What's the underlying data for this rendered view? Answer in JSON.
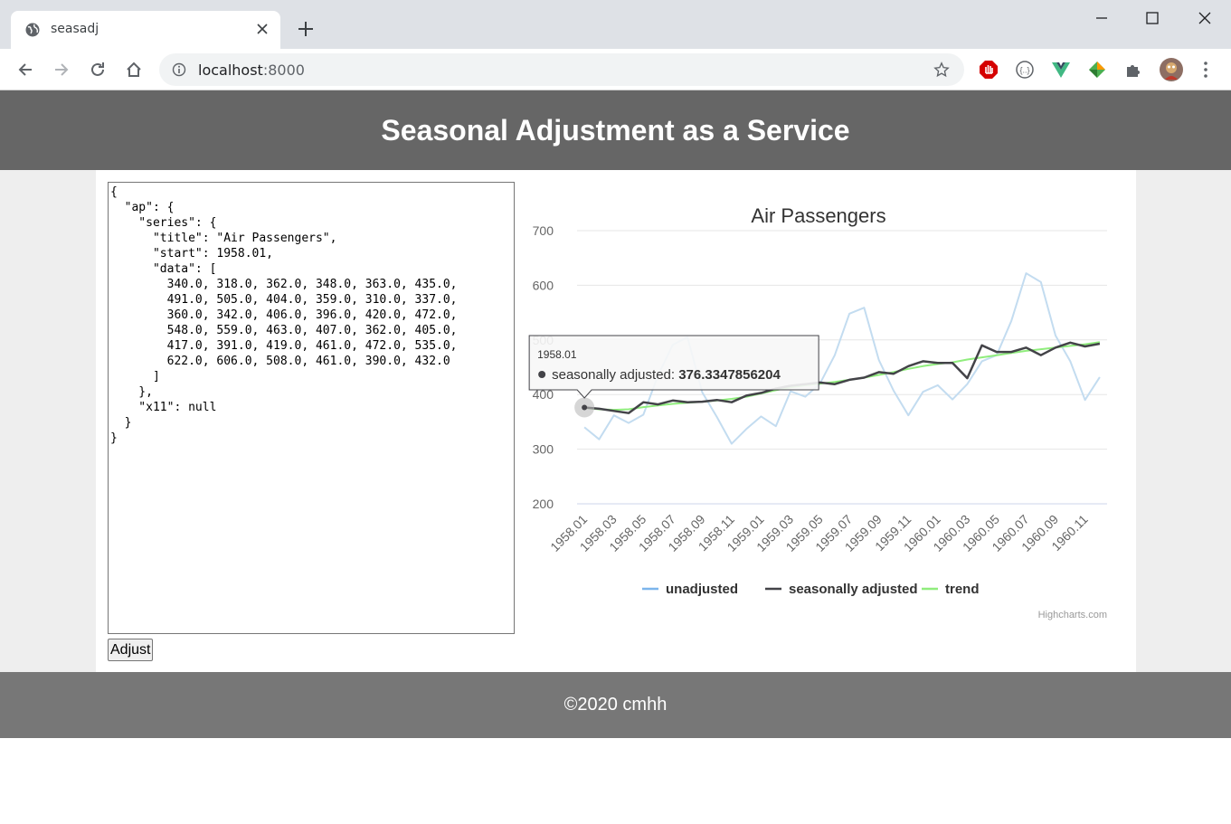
{
  "browser": {
    "tab_title": "seasadj",
    "url_host": "localhost",
    "url_port": ":8000"
  },
  "page": {
    "title": "Seasonal Adjustment as a Service",
    "footer": "©2020 cmhh",
    "adjust_label": "Adjust",
    "editor_text": "{\n  \"ap\": {\n    \"series\": {\n      \"title\": \"Air Passengers\",\n      \"start\": 1958.01,\n      \"data\": [\n        340.0, 318.0, 362.0, 348.0, 363.0, 435.0,\n        491.0, 505.0, 404.0, 359.0, 310.0, 337.0,\n        360.0, 342.0, 406.0, 396.0, 420.0, 472.0,\n        548.0, 559.0, 463.0, 407.0, 362.0, 405.0,\n        417.0, 391.0, 419.0, 461.0, 472.0, 535.0,\n        622.0, 606.0, 508.0, 461.0, 390.0, 432.0\n      ]\n    },\n    \"x11\": null\n  }\n}"
  },
  "chart_data": {
    "type": "line",
    "title": "Air Passengers",
    "credits": "Highcharts.com",
    "ylim": [
      200,
      700
    ],
    "yticks": [
      200,
      300,
      400,
      500,
      600,
      700
    ],
    "grid": true,
    "legend_position": "bottom",
    "categories": [
      "1958.01",
      "1958.02",
      "1958.03",
      "1958.04",
      "1958.05",
      "1958.06",
      "1958.07",
      "1958.08",
      "1958.09",
      "1958.10",
      "1958.11",
      "1958.12",
      "1959.01",
      "1959.02",
      "1959.03",
      "1959.04",
      "1959.05",
      "1959.06",
      "1959.07",
      "1959.08",
      "1959.09",
      "1959.10",
      "1959.11",
      "1959.12",
      "1960.01",
      "1960.02",
      "1960.03",
      "1960.04",
      "1960.05",
      "1960.06",
      "1960.07",
      "1960.08",
      "1960.09",
      "1960.10",
      "1960.11",
      "1960.12"
    ],
    "xtick_labels": [
      "1958.01",
      "1958.03",
      "1958.05",
      "1958.07",
      "1958.09",
      "1958.11",
      "1959.01",
      "1959.03",
      "1959.05",
      "1959.07",
      "1959.09",
      "1959.11",
      "1960.01",
      "1960.03",
      "1960.05",
      "1960.07",
      "1960.09",
      "1960.11"
    ],
    "series": [
      {
        "name": "unadjusted",
        "color": "#c3dcf0",
        "legend_color": "#7cb5ec",
        "values": [
          340,
          318,
          362,
          348,
          363,
          435,
          491,
          505,
          404,
          359,
          310,
          337,
          360,
          342,
          406,
          396,
          420,
          472,
          548,
          559,
          463,
          407,
          362,
          405,
          417,
          391,
          419,
          461,
          472,
          535,
          622,
          606,
          508,
          461,
          390,
          432
        ]
      },
      {
        "name": "seasonally adjusted",
        "color": "#434348",
        "legend_color": "#434348",
        "values": [
          376.3347856204,
          374,
          370,
          366,
          386,
          382,
          389,
          386,
          387,
          390,
          386,
          398,
          403,
          411,
          416,
          419,
          422,
          419,
          427,
          431,
          441,
          438,
          452,
          461,
          458,
          458,
          430,
          490,
          478,
          478,
          486,
          472,
          486,
          495,
          488,
          493
        ]
      },
      {
        "name": "trend",
        "color": "#90ed7d",
        "legend_color": "#90ed7d",
        "values": [
          376,
          373,
          372,
          373,
          377,
          380,
          383,
          385,
          387,
          389,
          392,
          396,
          402,
          408,
          413,
          417,
          420,
          423,
          427,
          431,
          436,
          441,
          447,
          452,
          456,
          459,
          464,
          468,
          472,
          476,
          480,
          483,
          486,
          489,
          492,
          496
        ]
      }
    ],
    "tooltip": {
      "category": "1958.01",
      "series": "seasonally adjusted",
      "label": "seasonally adjusted: ",
      "value": "376.3347856204"
    }
  }
}
